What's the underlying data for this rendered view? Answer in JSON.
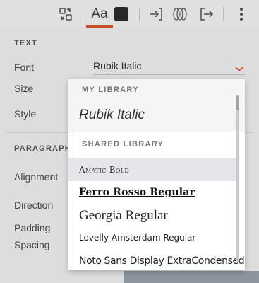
{
  "toolbar": {
    "aa_label": "Aa",
    "swatch_color": "#2b2b2b",
    "accent_color": "#e0552b",
    "icons": [
      "layout-swap-icon",
      "text-style-icon",
      "color-swatch-icon",
      "enter-icon",
      "stack-icon",
      "exit-icon",
      "more-icon"
    ]
  },
  "panel": {
    "text_section": "TEXT",
    "font_label": "Font",
    "font_value": "Rubik Italic",
    "size_label": "Size",
    "style_label": "Style",
    "paragraph_section": "PARAGRAPH",
    "alignment_label": "Alignment",
    "direction_label": "Direction",
    "padding_label": "Padding",
    "spacing_label": "Spacing"
  },
  "dropdown": {
    "my_library_header": "MY LIBRARY",
    "my_library_item": "Rubik Italic",
    "shared_library_header": "SHARED LIBRARY",
    "shared_items": [
      "Amatic Bold",
      "Ferro Rosso Regular",
      "Georgia Regular",
      "Lovelly Amsterdam Regular",
      "Noto Sans Display ExtraCondensed"
    ],
    "highlighted_item": "Amatic Bold"
  }
}
